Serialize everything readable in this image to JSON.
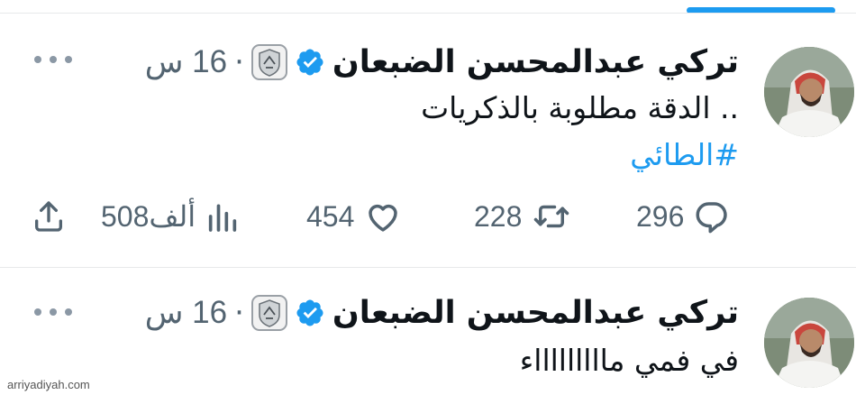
{
  "tweets": [
    {
      "display_name": "تركي عبدالمحسن الضبعان",
      "separator": "·",
      "time": "16 س",
      "text": ".. الدقة مطلوبة بالذكريات",
      "hashtag": "#الطائي",
      "actions": {
        "replies": "296",
        "retweets": "228",
        "likes": "454",
        "views": "508ألف"
      }
    },
    {
      "display_name": "تركي عبدالمحسن الضبعان",
      "separator": "·",
      "time": "16 س",
      "text": "في فمي ماااااااااء"
    }
  ],
  "watermark": "arriyadiyah.com",
  "icons": {
    "verified": "verified-badge-icon",
    "affiliate": "club-affiliate-badge-icon",
    "more": "more-dots-icon",
    "reply": "reply-bubble-icon",
    "retweet": "retweet-icon",
    "like": "heart-icon",
    "views": "views-bars-icon",
    "share": "share-upload-icon"
  },
  "colors": {
    "accent": "#1d9bf0",
    "text": "#0f1419",
    "secondary": "#536471"
  }
}
